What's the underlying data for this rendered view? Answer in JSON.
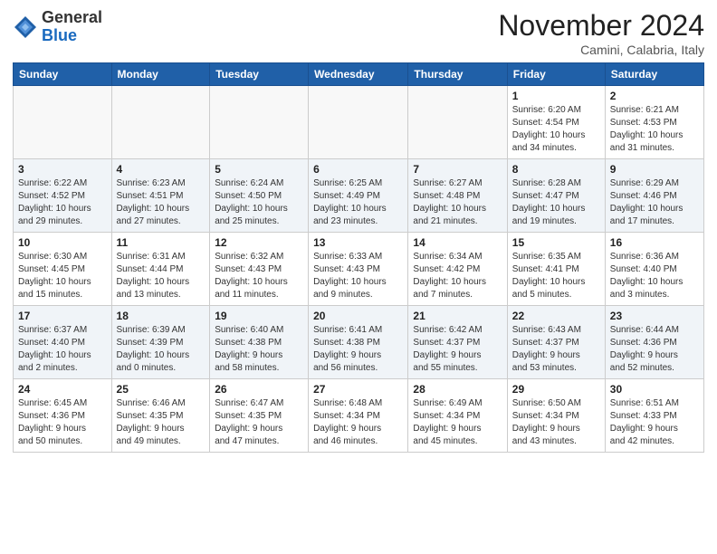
{
  "header": {
    "logo_general": "General",
    "logo_blue": "Blue",
    "month_title": "November 2024",
    "location": "Camini, Calabria, Italy"
  },
  "weekdays": [
    "Sunday",
    "Monday",
    "Tuesday",
    "Wednesday",
    "Thursday",
    "Friday",
    "Saturday"
  ],
  "weeks": [
    [
      {
        "day": "",
        "info": ""
      },
      {
        "day": "",
        "info": ""
      },
      {
        "day": "",
        "info": ""
      },
      {
        "day": "",
        "info": ""
      },
      {
        "day": "",
        "info": ""
      },
      {
        "day": "1",
        "info": "Sunrise: 6:20 AM\nSunset: 4:54 PM\nDaylight: 10 hours\nand 34 minutes."
      },
      {
        "day": "2",
        "info": "Sunrise: 6:21 AM\nSunset: 4:53 PM\nDaylight: 10 hours\nand 31 minutes."
      }
    ],
    [
      {
        "day": "3",
        "info": "Sunrise: 6:22 AM\nSunset: 4:52 PM\nDaylight: 10 hours\nand 29 minutes."
      },
      {
        "day": "4",
        "info": "Sunrise: 6:23 AM\nSunset: 4:51 PM\nDaylight: 10 hours\nand 27 minutes."
      },
      {
        "day": "5",
        "info": "Sunrise: 6:24 AM\nSunset: 4:50 PM\nDaylight: 10 hours\nand 25 minutes."
      },
      {
        "day": "6",
        "info": "Sunrise: 6:25 AM\nSunset: 4:49 PM\nDaylight: 10 hours\nand 23 minutes."
      },
      {
        "day": "7",
        "info": "Sunrise: 6:27 AM\nSunset: 4:48 PM\nDaylight: 10 hours\nand 21 minutes."
      },
      {
        "day": "8",
        "info": "Sunrise: 6:28 AM\nSunset: 4:47 PM\nDaylight: 10 hours\nand 19 minutes."
      },
      {
        "day": "9",
        "info": "Sunrise: 6:29 AM\nSunset: 4:46 PM\nDaylight: 10 hours\nand 17 minutes."
      }
    ],
    [
      {
        "day": "10",
        "info": "Sunrise: 6:30 AM\nSunset: 4:45 PM\nDaylight: 10 hours\nand 15 minutes."
      },
      {
        "day": "11",
        "info": "Sunrise: 6:31 AM\nSunset: 4:44 PM\nDaylight: 10 hours\nand 13 minutes."
      },
      {
        "day": "12",
        "info": "Sunrise: 6:32 AM\nSunset: 4:43 PM\nDaylight: 10 hours\nand 11 minutes."
      },
      {
        "day": "13",
        "info": "Sunrise: 6:33 AM\nSunset: 4:43 PM\nDaylight: 10 hours\nand 9 minutes."
      },
      {
        "day": "14",
        "info": "Sunrise: 6:34 AM\nSunset: 4:42 PM\nDaylight: 10 hours\nand 7 minutes."
      },
      {
        "day": "15",
        "info": "Sunrise: 6:35 AM\nSunset: 4:41 PM\nDaylight: 10 hours\nand 5 minutes."
      },
      {
        "day": "16",
        "info": "Sunrise: 6:36 AM\nSunset: 4:40 PM\nDaylight: 10 hours\nand 3 minutes."
      }
    ],
    [
      {
        "day": "17",
        "info": "Sunrise: 6:37 AM\nSunset: 4:40 PM\nDaylight: 10 hours\nand 2 minutes."
      },
      {
        "day": "18",
        "info": "Sunrise: 6:39 AM\nSunset: 4:39 PM\nDaylight: 10 hours\nand 0 minutes."
      },
      {
        "day": "19",
        "info": "Sunrise: 6:40 AM\nSunset: 4:38 PM\nDaylight: 9 hours\nand 58 minutes."
      },
      {
        "day": "20",
        "info": "Sunrise: 6:41 AM\nSunset: 4:38 PM\nDaylight: 9 hours\nand 56 minutes."
      },
      {
        "day": "21",
        "info": "Sunrise: 6:42 AM\nSunset: 4:37 PM\nDaylight: 9 hours\nand 55 minutes."
      },
      {
        "day": "22",
        "info": "Sunrise: 6:43 AM\nSunset: 4:37 PM\nDaylight: 9 hours\nand 53 minutes."
      },
      {
        "day": "23",
        "info": "Sunrise: 6:44 AM\nSunset: 4:36 PM\nDaylight: 9 hours\nand 52 minutes."
      }
    ],
    [
      {
        "day": "24",
        "info": "Sunrise: 6:45 AM\nSunset: 4:36 PM\nDaylight: 9 hours\nand 50 minutes."
      },
      {
        "day": "25",
        "info": "Sunrise: 6:46 AM\nSunset: 4:35 PM\nDaylight: 9 hours\nand 49 minutes."
      },
      {
        "day": "26",
        "info": "Sunrise: 6:47 AM\nSunset: 4:35 PM\nDaylight: 9 hours\nand 47 minutes."
      },
      {
        "day": "27",
        "info": "Sunrise: 6:48 AM\nSunset: 4:34 PM\nDaylight: 9 hours\nand 46 minutes."
      },
      {
        "day": "28",
        "info": "Sunrise: 6:49 AM\nSunset: 4:34 PM\nDaylight: 9 hours\nand 45 minutes."
      },
      {
        "day": "29",
        "info": "Sunrise: 6:50 AM\nSunset: 4:34 PM\nDaylight: 9 hours\nand 43 minutes."
      },
      {
        "day": "30",
        "info": "Sunrise: 6:51 AM\nSunset: 4:33 PM\nDaylight: 9 hours\nand 42 minutes."
      }
    ]
  ]
}
